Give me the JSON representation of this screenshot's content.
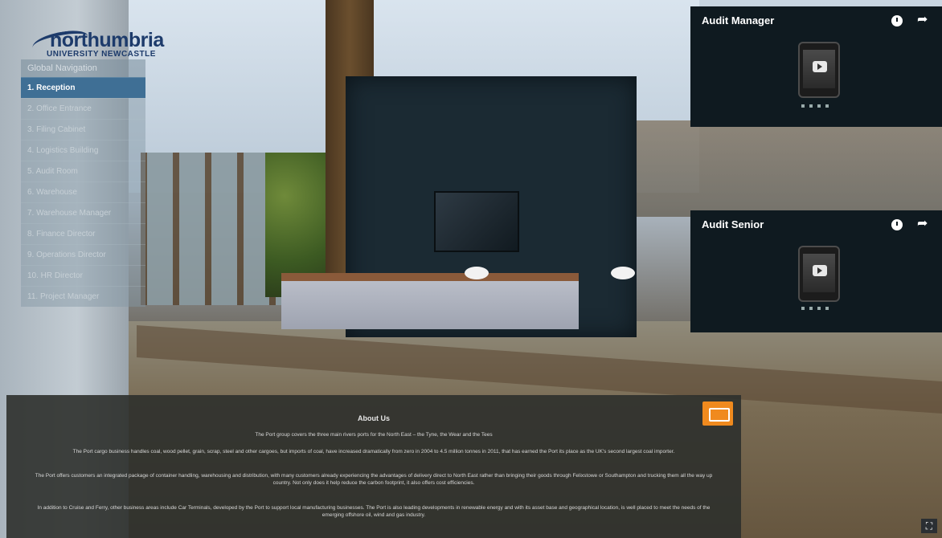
{
  "logo": {
    "main": "northumbria",
    "sub": "UNIVERSITY NEWCASTLE"
  },
  "nav": {
    "title": "Global Navigation",
    "items": [
      {
        "label": "1. Reception",
        "active": true
      },
      {
        "label": "2. Office Entrance"
      },
      {
        "label": "3. Filing Cabinet"
      },
      {
        "label": "4. Logistics Building"
      },
      {
        "label": "5. Audit Room"
      },
      {
        "label": "6. Warehouse"
      },
      {
        "label": "7. Warehouse Manager"
      },
      {
        "label": "8. Finance Director"
      },
      {
        "label": "9. Operations Director"
      },
      {
        "label": "10. HR Director"
      },
      {
        "label": "11. Project Manager"
      }
    ]
  },
  "panels": {
    "audit_manager": {
      "title": "Audit Manager",
      "icons": [
        "clock-icon",
        "share-icon"
      ]
    },
    "audit_senior": {
      "title": "Audit Senior",
      "icons": [
        "clock-icon",
        "share-icon"
      ]
    }
  },
  "about": {
    "title": "About Us",
    "p1": "The Port group covers the three main rivers ports for the North East – the Tyne, the Wear and the Tees",
    "p2": "The Port cargo business handles coal, wood pellet, grain, scrap, steel and other cargoes, but imports of coal, have increased dramatically from zero in 2004 to 4.5 million tonnes in 2011, that has earned the Port its place as the UK's second largest coal importer.",
    "p3": "The Port offers customers an integrated package of container handling, warehousing and distribution, with many customers already experiencing the advantages of delivery direct to North East rather than bringing their goods through Felixstowe or Southampton and trucking them all the way up country. Not only does it help reduce the carbon footprint, it also offers cost efficiencies.",
    "p4": "In addition to Cruise and Ferry, other business areas include Car Terminals, developed by the Port to support local manufacturing businesses. The Port is also leading developments in renewable energy and with its asset base and geographical location, is well placed to meet the needs of the emerging offshore oil, wind and gas industry.",
    "icon": "presentation-icon"
  },
  "colors": {
    "nav_active": "#3f6f95",
    "about_icon": "#f08a1e",
    "panel_bg": "#0f1a20"
  }
}
